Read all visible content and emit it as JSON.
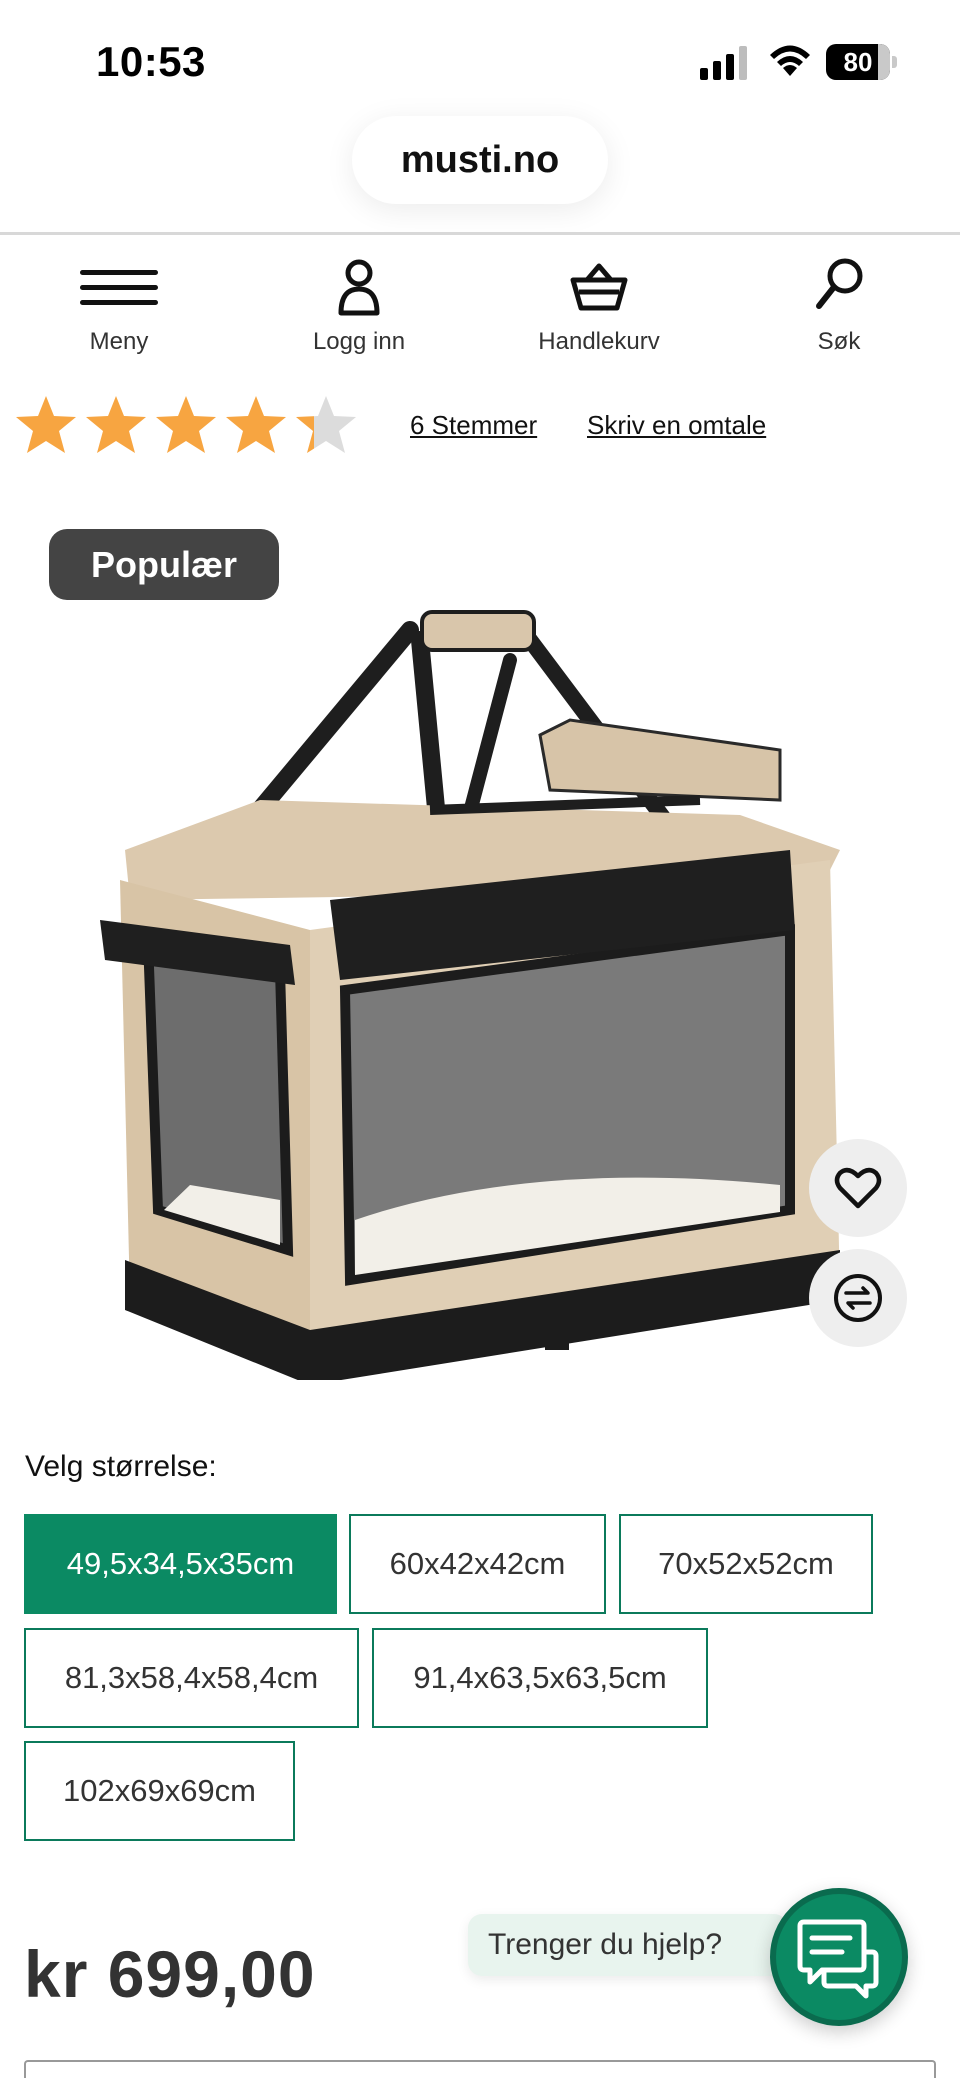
{
  "status_bar": {
    "time": "10:53",
    "battery": "80"
  },
  "browser": {
    "url": "musti.no"
  },
  "nav": {
    "menu_label": "Meny",
    "login_label": "Logg inn",
    "cart_label": "Handlekurv",
    "search_label": "Søk"
  },
  "rating": {
    "stars": 4.3,
    "max": 5,
    "votes_label": "6 Stemmer",
    "write_review_label": "Skriv en omtale"
  },
  "product": {
    "badge": "Populær",
    "size_prompt": "Velg størrelse:",
    "sizes": [
      "49,5x34,5x35cm",
      "60x42x42cm",
      "70x52x52cm",
      "81,3x58,4x58,4cm",
      "91,4x63,5x63,5cm",
      "102x69x69cm"
    ],
    "selected_size_index": 0,
    "price": "kr 699,00"
  },
  "help": {
    "label": "Trenger du hjelp?"
  },
  "colors": {
    "accent": "#0b8a63",
    "star": "#f7a541",
    "badge": "#444444"
  }
}
